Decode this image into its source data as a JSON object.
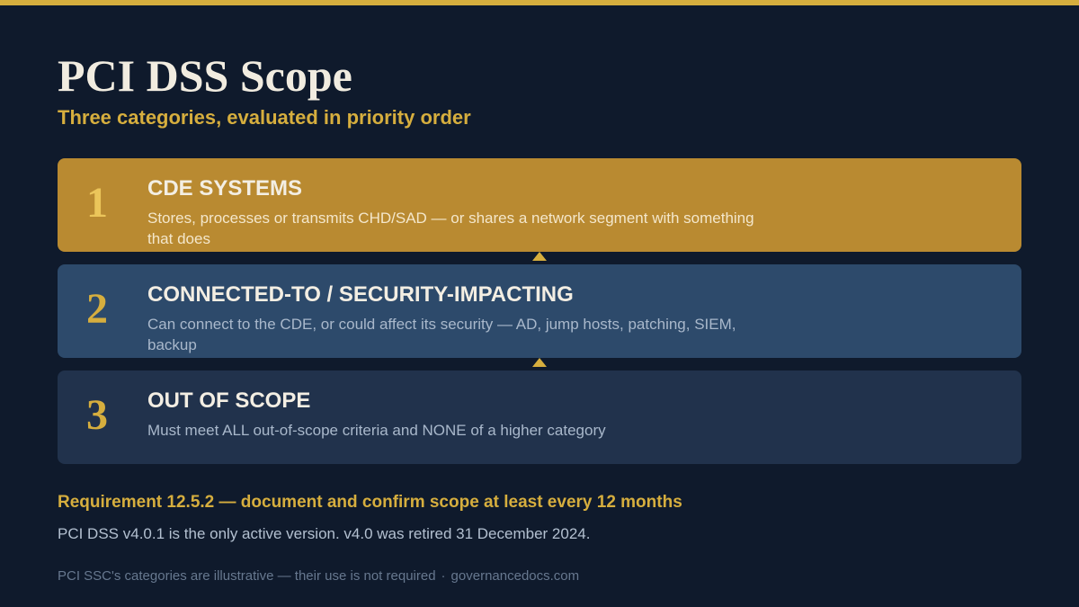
{
  "slide": {
    "title": "PCI DSS Scope",
    "subtitle": "Three categories, evaluated in priority order"
  },
  "categories": [
    {
      "number": "1",
      "title": "CDE SYSTEMS",
      "description": "Stores, processes or transmits CHD/SAD — or shares a network segment with something that does"
    },
    {
      "number": "2",
      "title": "CONNECTED-TO / SECURITY-IMPACTING",
      "description": "Can connect to the CDE, or could affect its security — AD, jump hosts, patching, SIEM, backup"
    },
    {
      "number": "3",
      "title": "OUT OF SCOPE",
      "description": "Must meet ALL out-of-scope criteria and NONE of a higher category"
    }
  ],
  "requirement": "Requirement 12.5.2 — document and confirm scope at least every 12 months",
  "version_note": "PCI DSS v4.0.1 is the only active version. v4.0 was retired 31 December 2024.",
  "footer": {
    "disclaimer": "PCI SSC's categories are illustrative — their use is not required",
    "separator": "·",
    "source": "governancedocs.com"
  },
  "colors": {
    "background": "#0f1a2c",
    "accent": "#d6ae3e",
    "category_1": "#b98a31",
    "category_2": "#2d4a6b",
    "category_3": "#21324c"
  }
}
